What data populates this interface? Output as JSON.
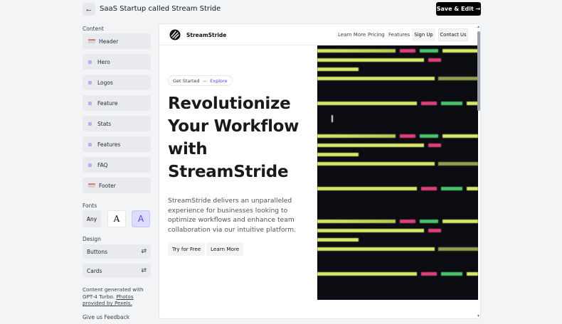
{
  "header": {
    "title": "SaaS Startup called Stream Stride",
    "save_label": "Save & Edit →",
    "back_icon": "arrow-left-icon"
  },
  "sidebar": {
    "content_label": "Content",
    "sections": [
      {
        "label": "Header",
        "icon": "header-bar-icon"
      },
      {
        "label": "Hero",
        "icon": "dot-icon"
      },
      {
        "label": "Logos",
        "icon": "dot-icon"
      },
      {
        "label": "Feature",
        "icon": "dot-icon"
      },
      {
        "label": "Stats",
        "icon": "dot-icon"
      },
      {
        "label": "Features",
        "icon": "dot-icon"
      },
      {
        "label": "FAQ",
        "icon": "dot-icon"
      },
      {
        "label": "Footer",
        "icon": "footer-bar-icon"
      }
    ],
    "fonts_label": "Fonts",
    "fonts": {
      "any": "Any",
      "serif": "A",
      "sans": "A"
    },
    "design_label": "Design",
    "design_items": [
      {
        "label": "Buttons",
        "icon": "shuffle-icon"
      },
      {
        "label": "Cards",
        "icon": "shuffle-icon"
      }
    ],
    "credit_text": "Content generated with GPT-4 Turbo.",
    "credit_link": "Photos provided by Pexels.",
    "feedback": "Give us Feedback"
  },
  "preview": {
    "logo_text": "StreamStride",
    "nav_links": [
      "Learn More",
      "Pricing",
      "Features"
    ],
    "signup": "Sign Up",
    "contact": "Contact Us",
    "badge_text": "Get Started",
    "badge_sep": "—",
    "badge_link": "Explore",
    "hero_title": "Revolutionize Your Workflow with StreamStride",
    "hero_desc": "StreamStride delivers an unparalleled experience for businesses looking to optimize workflows and enhance team collaboration via our intuitive platform.",
    "cta_primary": "Try for Free",
    "cta_secondary": "Learn More"
  },
  "colors": {
    "accent": "#4f46e5",
    "code_bg": "#0b0d12",
    "code_text": "#d8e86a",
    "code_tag": "#e0407a",
    "code_attr": "#49c46a"
  }
}
